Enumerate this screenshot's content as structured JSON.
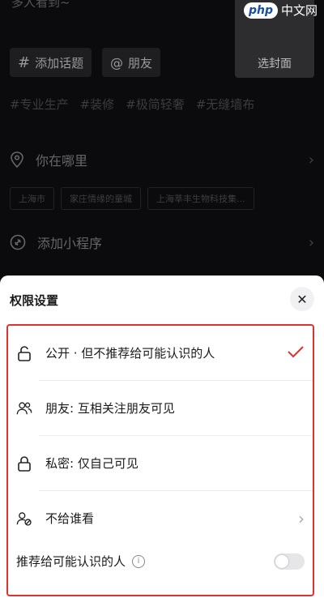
{
  "topline": "多人看到~",
  "cover_label": "选封面",
  "chips": {
    "topic": "添加话题",
    "friend": "朋友"
  },
  "hashtags": [
    "#专业生产",
    "#装修",
    "#极简轻奢",
    "#无缝墙布"
  ],
  "location": {
    "label": "你在哪里",
    "chips": [
      "上海市",
      "家庄情缘的童城",
      "上海莘丰生物科技集..."
    ]
  },
  "miniprogram": {
    "label": "添加小程序"
  },
  "watermark": {
    "logo": "php",
    "text": "中文网"
  },
  "sheet": {
    "title": "权限设置",
    "options": [
      {
        "label": "公开 · 但不推荐给可能认识的人",
        "selected": true
      },
      {
        "label": "朋友: 互相关注朋友可见",
        "selected": false
      },
      {
        "label": "私密: 仅自己可见",
        "selected": false
      },
      {
        "label": "不给谁看",
        "has_arrow": true
      }
    ],
    "recommend_label": "推荐给可能认识的人",
    "recommend_enabled": false,
    "colors": {
      "highlight_border": "#e0312f",
      "check": "#e0312f"
    }
  }
}
